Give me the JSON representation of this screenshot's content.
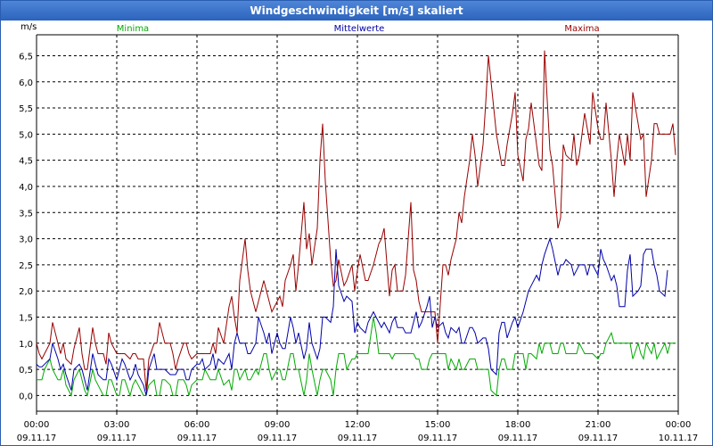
{
  "window": {
    "title": "Windgeschwindigkeit [m/s] skaliert"
  },
  "chart_data": {
    "type": "line",
    "title": "Windgeschwindigkeit [m/s] skaliert",
    "ylabel": "m/s",
    "xlabel": "",
    "ylim": [
      -0.3,
      6.9
    ],
    "xlim_hours": [
      0,
      24
    ],
    "grid": true,
    "legend_position": "top",
    "yticks": [
      "0,0",
      "0,5",
      "1,0",
      "1,5",
      "2,0",
      "2,5",
      "3,0",
      "3,5",
      "4,0",
      "4,5",
      "5,0",
      "5,5",
      "6,0",
      "6,5"
    ],
    "xticks": [
      {
        "time": "00:00",
        "date": "09.11.17"
      },
      {
        "time": "03:00",
        "date": "09.11.17"
      },
      {
        "time": "06:00",
        "date": "09.11.17"
      },
      {
        "time": "09:00",
        "date": "09.11.17"
      },
      {
        "time": "12:00",
        "date": "09.11.17"
      },
      {
        "time": "15:00",
        "date": "09.11.17"
      },
      {
        "time": "18:00",
        "date": "09.11.17"
      },
      {
        "time": "21:00",
        "date": "09.11.17"
      },
      {
        "time": "00:00",
        "date": "10.11.17"
      }
    ],
    "series": [
      {
        "name": "Minima",
        "color": "#00aa00",
        "hours": [
          0,
          0.1,
          0.2,
          0.3,
          0.5,
          0.6,
          0.8,
          0.9,
          1.0,
          1.1,
          1.3,
          1.4,
          1.6,
          1.7,
          1.8,
          1.9,
          2.1,
          2.2,
          2.3,
          2.5,
          2.6,
          2.7,
          2.8,
          3.0,
          3.1,
          3.2,
          3.3,
          3.5,
          3.6,
          3.7,
          3.8,
          4.0,
          4.1,
          4.2,
          4.4,
          4.5,
          4.6,
          4.7,
          4.8,
          5.0,
          5.1,
          5.2,
          5.3,
          5.5,
          5.6,
          5.7,
          5.8,
          6.0,
          6.1,
          6.2,
          6.3,
          6.5,
          6.6,
          6.7,
          6.8,
          7.0,
          7.2,
          7.3,
          7.4,
          7.5,
          7.6,
          7.8,
          7.9,
          8.0,
          8.2,
          8.3,
          8.5,
          8.6,
          8.7,
          8.8,
          9.0,
          9.1,
          9.2,
          9.3,
          9.5,
          9.6,
          9.7,
          9.8,
          10.0,
          10.1,
          10.2,
          10.3,
          10.5,
          10.6,
          10.7,
          10.8,
          11.0,
          11.1,
          11.2,
          11.3,
          11.5,
          11.6,
          11.8,
          11.9,
          12.0,
          12.1,
          12.3,
          12.4,
          12.6,
          12.7,
          12.8,
          12.9,
          13.0,
          13.2,
          13.3,
          13.4,
          13.5,
          13.7,
          13.8,
          14.0,
          14.1,
          14.2,
          14.3,
          14.4,
          14.6,
          14.7,
          14.8,
          14.9,
          15.0,
          15.2,
          15.3,
          15.4,
          15.5,
          15.7,
          15.8,
          15.9,
          16.0,
          16.2,
          16.3,
          16.4,
          16.5,
          16.7,
          16.8,
          16.9,
          17.0,
          17.2,
          17.3,
          17.4,
          17.5,
          17.6,
          17.8,
          17.9,
          18.0,
          18.2,
          18.3,
          18.4,
          18.5,
          18.7,
          18.8,
          18.9,
          19.0,
          19.2,
          19.3,
          19.5,
          19.6,
          19.7,
          19.8,
          20.0,
          20.1,
          20.2,
          20.3,
          20.5,
          20.6,
          20.7,
          20.8,
          21.0,
          21.1,
          21.2,
          21.3,
          21.5,
          21.6,
          21.7,
          21.8,
          22.0,
          22.1,
          22.2,
          22.3,
          22.5,
          22.6,
          22.7,
          22.8,
          23.0,
          23.1,
          23.2,
          23.3,
          23.5,
          23.6,
          23.7,
          23.8,
          23.9
        ],
        "values": [
          0.3,
          0.3,
          0.3,
          0.5,
          0.7,
          0.5,
          0.3,
          0.3,
          0.5,
          0.2,
          0.0,
          0.3,
          0.5,
          0.3,
          0.1,
          0.0,
          0.5,
          0.3,
          0.2,
          0.0,
          0.0,
          0.3,
          0.3,
          0.0,
          0.0,
          0.3,
          0.3,
          0.0,
          0.2,
          0.3,
          0.2,
          0.0,
          0.0,
          0.2,
          0.3,
          0.0,
          0.0,
          0.3,
          0.3,
          0.2,
          0.0,
          0.0,
          0.3,
          0.3,
          0.2,
          0.0,
          0.2,
          0.3,
          0.3,
          0.3,
          0.5,
          0.3,
          0.3,
          0.3,
          0.5,
          0.2,
          0.3,
          0.1,
          0.5,
          0.5,
          0.3,
          0.5,
          0.3,
          0.3,
          0.5,
          0.4,
          0.8,
          0.8,
          0.5,
          0.3,
          0.5,
          0.5,
          0.3,
          0.3,
          0.8,
          0.8,
          0.5,
          0.5,
          0.0,
          0.3,
          0.8,
          0.5,
          0.0,
          0.3,
          0.5,
          0.5,
          0.3,
          0.0,
          0.5,
          0.8,
          0.8,
          0.5,
          0.7,
          0.7,
          0.8,
          0.8,
          0.8,
          0.8,
          1.5,
          1.2,
          0.8,
          0.8,
          0.8,
          0.8,
          0.7,
          0.8,
          0.8,
          0.8,
          0.8,
          0.8,
          0.8,
          0.7,
          0.7,
          0.5,
          0.5,
          0.7,
          0.8,
          0.8,
          0.8,
          0.8,
          0.8,
          0.5,
          0.7,
          0.5,
          0.7,
          0.5,
          0.5,
          0.7,
          0.7,
          0.7,
          0.5,
          0.5,
          0.5,
          0.5,
          0.1,
          0.0,
          0.5,
          0.7,
          0.7,
          0.5,
          0.5,
          0.8,
          0.8,
          0.8,
          0.5,
          0.8,
          0.8,
          0.7,
          1.0,
          0.8,
          1.0,
          1.0,
          0.8,
          0.8,
          1.0,
          1.0,
          0.8,
          0.8,
          0.8,
          0.8,
          1.0,
          0.8,
          0.8,
          0.8,
          0.8,
          0.7,
          0.8,
          0.8,
          1.0,
          1.2,
          1.0,
          1.0,
          1.0,
          1.0,
          1.0,
          1.0,
          0.7,
          1.0,
          0.8,
          0.7,
          1.0,
          0.8,
          1.0,
          0.7,
          0.8,
          1.0,
          0.8,
          1.0,
          1.0,
          1.0,
          1.0,
          1.0
        ]
      },
      {
        "name": "Mittelwerte",
        "color": "#0000aa",
        "hours": [
          0,
          0.1,
          0.2,
          0.3,
          0.5,
          0.6,
          0.8,
          0.9,
          1.0,
          1.1,
          1.3,
          1.4,
          1.6,
          1.7,
          1.8,
          1.9,
          2.1,
          2.2,
          2.3,
          2.5,
          2.6,
          2.7,
          2.8,
          3.0,
          3.1,
          3.2,
          3.3,
          3.5,
          3.6,
          3.7,
          3.8,
          4.0,
          4.1,
          4.2,
          4.4,
          4.5,
          4.6,
          4.7,
          4.8,
          5.0,
          5.1,
          5.2,
          5.3,
          5.5,
          5.6,
          5.7,
          5.8,
          6.0,
          6.1,
          6.2,
          6.3,
          6.5,
          6.6,
          6.7,
          6.8,
          7.0,
          7.2,
          7.3,
          7.4,
          7.5,
          7.6,
          7.8,
          7.9,
          8.0,
          8.2,
          8.3,
          8.5,
          8.6,
          8.7,
          8.8,
          9.0,
          9.1,
          9.2,
          9.3,
          9.5,
          9.6,
          9.7,
          9.8,
          10.0,
          10.1,
          10.2,
          10.3,
          10.5,
          10.6,
          10.7,
          10.8,
          11.0,
          11.1,
          11.2,
          11.3,
          11.5,
          11.6,
          11.8,
          11.9,
          12.0,
          12.1,
          12.3,
          12.4,
          12.6,
          12.7,
          12.8,
          12.9,
          13.0,
          13.2,
          13.3,
          13.4,
          13.5,
          13.7,
          13.8,
          14.0,
          14.1,
          14.2,
          14.3,
          14.4,
          14.6,
          14.7,
          14.8,
          14.9,
          15.0,
          15.2,
          15.3,
          15.4,
          15.5,
          15.7,
          15.8,
          15.9,
          16.0,
          16.2,
          16.3,
          16.4,
          16.5,
          16.7,
          16.8,
          16.9,
          17.0,
          17.2,
          17.3,
          17.4,
          17.5,
          17.6,
          17.8,
          17.9,
          18.0,
          18.2,
          18.3,
          18.4,
          18.5,
          18.7,
          18.8,
          18.9,
          19.0,
          19.2,
          19.3,
          19.5,
          19.6,
          19.7,
          19.8,
          20.0,
          20.1,
          20.2,
          20.3,
          20.5,
          20.6,
          20.7,
          20.8,
          21.0,
          21.1,
          21.2,
          21.3,
          21.5,
          21.6,
          21.7,
          21.8,
          22.0,
          22.1,
          22.2,
          22.3,
          22.5,
          22.6,
          22.7,
          22.8,
          23.0,
          23.1,
          23.2,
          23.3,
          23.5,
          23.6,
          23.7,
          23.8,
          23.9
        ],
        "values": [
          0.6,
          0.55,
          0.55,
          0.6,
          0.7,
          1.0,
          0.7,
          0.5,
          0.6,
          0.4,
          0.1,
          0.5,
          0.6,
          0.5,
          0.3,
          0.1,
          0.8,
          0.6,
          0.4,
          0.3,
          0.3,
          0.7,
          0.6,
          0.3,
          0.5,
          0.7,
          0.6,
          0.3,
          0.4,
          0.6,
          0.4,
          0.2,
          0.0,
          0.5,
          0.8,
          0.5,
          0.5,
          0.5,
          0.5,
          0.4,
          0.4,
          0.4,
          0.5,
          0.5,
          0.3,
          0.3,
          0.5,
          0.6,
          0.6,
          0.7,
          0.5,
          0.6,
          0.8,
          0.5,
          0.7,
          0.6,
          0.8,
          0.5,
          1.0,
          1.2,
          1.0,
          1.0,
          0.8,
          0.8,
          1.0,
          1.5,
          1.2,
          1.0,
          1.2,
          0.8,
          1.2,
          1.0,
          0.9,
          0.9,
          1.5,
          1.3,
          1.0,
          1.2,
          0.7,
          0.9,
          1.4,
          1.0,
          0.7,
          0.9,
          1.5,
          1.5,
          1.4,
          1.7,
          2.8,
          2.1,
          1.8,
          1.9,
          1.8,
          1.2,
          1.4,
          1.3,
          1.2,
          1.4,
          1.6,
          1.5,
          1.4,
          1.3,
          1.4,
          1.2,
          1.4,
          1.5,
          1.3,
          1.3,
          1.2,
          1.2,
          1.4,
          1.6,
          1.3,
          1.4,
          1.7,
          1.9,
          1.3,
          1.5,
          1.3,
          1.4,
          1.2,
          1.1,
          1.3,
          1.2,
          1.3,
          1.0,
          1.0,
          1.3,
          1.3,
          1.2,
          1.0,
          1.1,
          1.1,
          0.9,
          0.5,
          0.4,
          1.2,
          1.4,
          1.4,
          1.1,
          1.4,
          1.5,
          1.3,
          1.6,
          1.8,
          2.0,
          2.1,
          2.3,
          2.2,
          2.5,
          2.7,
          3.0,
          2.8,
          2.3,
          2.5,
          2.5,
          2.6,
          2.5,
          2.3,
          2.4,
          2.5,
          2.5,
          2.3,
          2.5,
          2.5,
          2.3,
          2.8,
          2.6,
          2.5,
          2.2,
          2.3,
          2.1,
          1.7,
          1.7,
          2.4,
          2.7,
          1.9,
          2.0,
          2.1,
          2.7,
          2.8,
          2.8,
          2.5,
          2.3,
          2.0,
          1.9,
          2.4
        ]
      },
      {
        "name": "Maxima",
        "color": "#990000",
        "hours": [
          0,
          0.1,
          0.2,
          0.3,
          0.5,
          0.6,
          0.8,
          0.9,
          1.0,
          1.1,
          1.3,
          1.4,
          1.6,
          1.7,
          1.8,
          1.9,
          2.1,
          2.2,
          2.3,
          2.5,
          2.6,
          2.7,
          2.8,
          3.0,
          3.1,
          3.2,
          3.3,
          3.5,
          3.6,
          3.7,
          3.8,
          4.0,
          4.1,
          4.2,
          4.4,
          4.5,
          4.6,
          4.7,
          4.8,
          5.0,
          5.1,
          5.2,
          5.3,
          5.5,
          5.6,
          5.7,
          5.8,
          6.0,
          6.1,
          6.2,
          6.3,
          6.5,
          6.6,
          6.7,
          6.8,
          7.0,
          7.2,
          7.3,
          7.4,
          7.5,
          7.6,
          7.8,
          7.9,
          8.0,
          8.2,
          8.3,
          8.5,
          8.6,
          8.7,
          8.8,
          9.0,
          9.1,
          9.2,
          9.3,
          9.5,
          9.6,
          9.7,
          9.8,
          10.0,
          10.1,
          10.2,
          10.3,
          10.5,
          10.6,
          10.7,
          10.8,
          11.0,
          11.1,
          11.2,
          11.3,
          11.5,
          11.6,
          11.8,
          11.9,
          12.0,
          12.1,
          12.3,
          12.4,
          12.6,
          12.7,
          12.8,
          12.9,
          13.0,
          13.2,
          13.3,
          13.4,
          13.5,
          13.7,
          13.8,
          14.0,
          14.1,
          14.2,
          14.3,
          14.4,
          14.6,
          14.7,
          14.8,
          14.9,
          15.0,
          15.2,
          15.3,
          15.4,
          15.5,
          15.7,
          15.8,
          15.9,
          16.0,
          16.2,
          16.3,
          16.4,
          16.5,
          16.7,
          16.8,
          16.9,
          17.0,
          17.2,
          17.3,
          17.4,
          17.5,
          17.6,
          17.8,
          17.9,
          18.0,
          18.2,
          18.3,
          18.4,
          18.5,
          18.7,
          18.8,
          18.9,
          19.0,
          19.2,
          19.3,
          19.5,
          19.6,
          19.7,
          19.8,
          20.0,
          20.1,
          20.2,
          20.3,
          20.5,
          20.6,
          20.7,
          20.8,
          21.0,
          21.1,
          21.2,
          21.3,
          21.5,
          21.6,
          21.7,
          21.8,
          22.0,
          22.1,
          22.2,
          22.3,
          22.5,
          22.6,
          22.7,
          22.8,
          23.0,
          23.1,
          23.2,
          23.3,
          23.5,
          23.6,
          23.7,
          23.8,
          23.9
        ],
        "values": [
          1.0,
          0.8,
          0.7,
          0.8,
          1.0,
          1.4,
          1.0,
          0.8,
          1.0,
          0.7,
          0.6,
          0.9,
          1.3,
          0.8,
          0.5,
          0.5,
          1.3,
          1.0,
          0.8,
          0.8,
          0.6,
          1.2,
          1.0,
          0.8,
          0.8,
          0.8,
          0.8,
          0.7,
          0.8,
          0.8,
          0.7,
          0.7,
          0.1,
          0.7,
          1.0,
          1.0,
          1.4,
          1.2,
          1.0,
          1.0,
          0.8,
          0.5,
          0.7,
          1.0,
          1.0,
          0.8,
          0.7,
          0.8,
          0.8,
          0.8,
          0.8,
          0.8,
          1.0,
          0.8,
          1.3,
          1.0,
          1.7,
          1.9,
          1.5,
          1.2,
          2.2,
          3.0,
          2.4,
          2.0,
          1.6,
          1.8,
          2.2,
          2.0,
          1.8,
          1.6,
          1.8,
          1.9,
          1.7,
          2.2,
          2.5,
          2.7,
          2.0,
          2.5,
          3.7,
          2.8,
          3.1,
          2.5,
          3.2,
          4.5,
          5.2,
          4.1,
          2.6,
          2.1,
          2.2,
          2.6,
          2.1,
          2.2,
          2.5,
          2.0,
          2.4,
          2.7,
          2.2,
          2.2,
          2.5,
          2.7,
          2.9,
          3.0,
          3.2,
          1.9,
          2.4,
          2.5,
          2.0,
          2.0,
          2.3,
          3.7,
          2.4,
          2.2,
          1.8,
          1.6,
          1.6,
          1.6,
          1.6,
          1.6,
          1.0,
          2.5,
          2.5,
          2.3,
          2.6,
          3.0,
          3.5,
          3.3,
          3.8,
          4.5,
          5.0,
          4.6,
          4.0,
          4.8,
          5.6,
          6.5,
          6.0,
          5.0,
          4.7,
          4.4,
          4.4,
          4.8,
          5.4,
          5.8,
          4.6,
          4.1,
          4.9,
          5.1,
          5.6,
          4.8,
          4.4,
          4.3,
          6.6,
          4.7,
          4.4,
          3.2,
          3.4,
          4.8,
          4.6,
          4.5,
          5.0,
          4.4,
          4.6,
          5.4,
          5.1,
          4.8,
          5.8,
          5.1,
          4.9,
          4.9,
          5.6,
          4.5,
          3.8,
          4.5,
          5.0,
          4.4,
          5.0,
          4.5,
          5.8,
          5.2,
          4.9,
          5.0,
          3.8,
          4.5,
          5.2,
          5.2,
          5.0,
          5.0,
          5.0,
          5.0,
          5.2,
          4.6,
          4.0,
          5.2
        ]
      }
    ]
  }
}
